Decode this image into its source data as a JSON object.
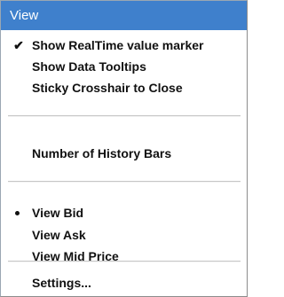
{
  "menu": {
    "title": "View",
    "items": [
      {
        "label": "Show RealTime value marker",
        "checked": true
      },
      {
        "label": "Show Data Tooltips"
      },
      {
        "label": "Sticky Crosshair to Close"
      },
      {
        "label": "Number of History Bars"
      },
      {
        "label": "View Bid",
        "selected": true
      },
      {
        "label": "View Ask"
      },
      {
        "label": "View Mid Price"
      },
      {
        "label": "Settings..."
      }
    ],
    "check_mark": "✔",
    "colors": {
      "header_background": "#3f80cc",
      "header_text": "#ffffff",
      "item_text": "#111111"
    }
  }
}
